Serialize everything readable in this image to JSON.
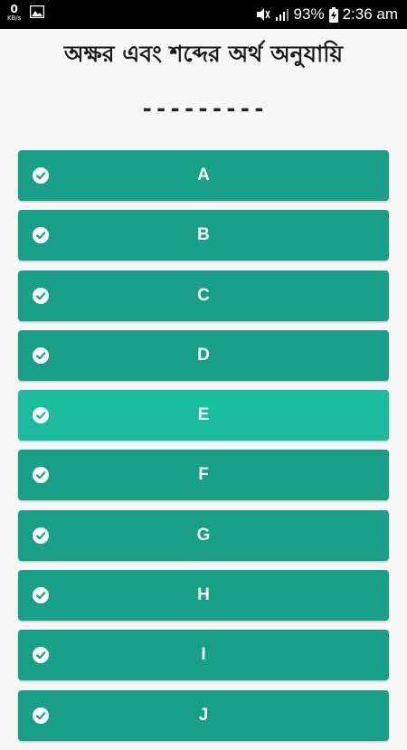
{
  "status_bar": {
    "net_speed_value": "0",
    "net_speed_unit": "KB/s",
    "battery": "93%",
    "time": "2:36 am"
  },
  "header": {
    "title": "অক্ষর এবং শব্দের অর্থ অনুযায়ি",
    "subtitle": "---------"
  },
  "items": [
    {
      "label": "A"
    },
    {
      "label": "B"
    },
    {
      "label": "C"
    },
    {
      "label": "D"
    },
    {
      "label": "E"
    },
    {
      "label": "F"
    },
    {
      "label": "G"
    },
    {
      "label": "H"
    },
    {
      "label": "I"
    },
    {
      "label": "J"
    }
  ],
  "colors": {
    "item": "#17a085",
    "item_highlight": "#1abc9c",
    "background": "#f7f7f7"
  }
}
